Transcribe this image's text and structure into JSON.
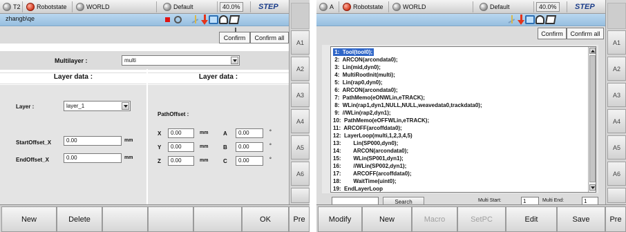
{
  "left": {
    "statusbar": {
      "mode": "T2",
      "robot": "Robotstate",
      "coord": "WORLD",
      "tool": "Default",
      "speed": "40.0%",
      "step": "STEP"
    },
    "user": "zhangb\\qe",
    "confirm": "Confirm",
    "confirm_all": "Confirm all",
    "side_buttons": [
      "A1",
      "A2",
      "A3",
      "A4",
      "A5",
      "A6"
    ],
    "multilayer_label": "Multilayer :",
    "multilayer_value": "multi",
    "layer_data_left": "Layer data :",
    "layer_data_right": "Layer data :",
    "layer_label": "Layer :",
    "layer_value": "layer_1",
    "start_offset_label": "StartOffset_X",
    "start_offset_value": "0.00",
    "end_offset_label": "EndOffset_X",
    "end_offset_value": "0.00",
    "unit_mm": "mm",
    "unit_deg": "°",
    "path_offset_label": "PathOffset :",
    "path_offset": {
      "x_label": "X",
      "x_value": "0.00",
      "y_label": "Y",
      "y_value": "0.00",
      "z_label": "Z",
      "z_value": "0.00",
      "a_label": "A",
      "a_value": "0.00",
      "b_label": "B",
      "b_value": "0.00",
      "c_label": "C",
      "c_value": "0.00"
    },
    "bottom": {
      "new": "New",
      "delete": "Delete",
      "ok": "OK",
      "pre": "Pre"
    }
  },
  "right": {
    "statusbar": {
      "mode": "A",
      "robot": "Robotstate",
      "coord": "WORLD",
      "tool": "Default",
      "speed": "40.0%",
      "step": "STEP"
    },
    "confirm": "Confirm",
    "confirm_all": "Confirm all",
    "side_buttons": [
      "A1",
      "A2",
      "A3",
      "A4",
      "A5",
      "A6"
    ],
    "program_lines": [
      " 1:  Tool(tool0);",
      " 2:  ARCON(arcondata0);",
      " 3:  Lin(mid,dyn0);",
      " 4:  MultiRootInit(multi);",
      " 5:  Lin(rap0,dyn0);",
      " 6:  ARCON(arcondata0);",
      " 7:  PathMemo(eONWLin,eTRACK);",
      " 8:  WLin(rap1,dyn1,NULL,NULL,weavedata0,trackdata0);",
      " 9:  //WLin(rap2,dyn1);",
      "10:  PathMemo(eOFFWLin,eTRACK);",
      "11:  ARCOFF(arcoffdata0);",
      "12:  LayerLoop(multi,1,2,3,4,5)",
      "13:        Lin(SP000,dyn0);",
      "14:        ARCON(arcondata0);",
      "15:        WLin(SP001,dyn1);",
      "16:        //WLin(SP002,dyn1);",
      "17:        ARCOFF(arcoffdata0);",
      "18:        WaitTime(uint0);",
      "19:  EndLayerLoop"
    ],
    "search_label": "Search",
    "multi_start_label": "Multi Start:",
    "multi_start_value": "1",
    "multi_end_label": "Multi End:",
    "multi_end_value": "1",
    "bottom": {
      "modify": "Modify",
      "new": "New",
      "macro": "Macro",
      "setpc": "SetPC",
      "edit": "Edit",
      "save": "Save",
      "pre": "Pre"
    }
  }
}
